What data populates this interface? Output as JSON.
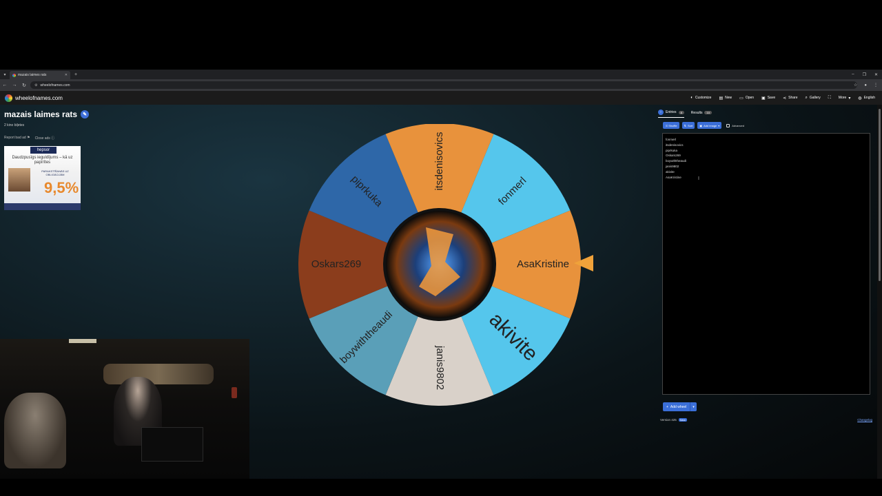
{
  "browser": {
    "tab_title": "mazais laimes rats",
    "url": "wheelofnames.com"
  },
  "header": {
    "logo_text": "wheelofnames.com",
    "menu": [
      {
        "label": "Customize",
        "icon": "palette-icon"
      },
      {
        "label": "New",
        "icon": "file-icon"
      },
      {
        "label": "Open",
        "icon": "folder-icon"
      },
      {
        "label": "Save",
        "icon": "save-icon"
      },
      {
        "label": "Share",
        "icon": "share-icon"
      },
      {
        "label": "Gallery",
        "icon": "search-icon"
      },
      {
        "label": "",
        "icon": "fullscreen-icon"
      },
      {
        "label": "More",
        "icon": "chevron-down-icon"
      },
      {
        "label": "English",
        "icon": "globe-icon"
      }
    ]
  },
  "page": {
    "title": "mazais laimes rats",
    "subtitle": "2 kino biļetes",
    "report_ad": "Report bad ad",
    "close_ads": "Close ads"
  },
  "ad": {
    "brand": "hepsor",
    "headline": "Daudzpusīgs ieguldījums – kā uz papīrītes",
    "tagline": "PARAKSTĪŠANĀS UZ OBLIGĀCIJĀM",
    "percent": "9,5%"
  },
  "wheel": {
    "segments": [
      {
        "label": "fonmerl",
        "color": "#55c6ec"
      },
      {
        "label": "AsaKristine",
        "color": "#e8923c"
      },
      {
        "label": "akivite",
        "color": "#55c6ec"
      },
      {
        "label": "janis9802",
        "color": "#d9d1c9"
      },
      {
        "label": "boywiththeaudi",
        "color": "#5a9fb8"
      },
      {
        "label": "Oskars269",
        "color": "#8b3d1c"
      },
      {
        "label": "piprkuka",
        "color": "#2e67a8"
      },
      {
        "label": "itsdenisovics",
        "color": "#e8923c"
      }
    ],
    "pointer_color": "#f0a23a"
  },
  "panel": {
    "tabs": [
      {
        "label": "Entries",
        "count": "8"
      },
      {
        "label": "Results",
        "count": "10"
      }
    ],
    "toolbar": {
      "shuffle": "Shuffle",
      "sort": "Sort",
      "add_image": "Add image",
      "advanced": "Advanced"
    },
    "entries": [
      "fonmerl",
      "itsdenisovics",
      "piprkuka",
      "Oskars269",
      "boywiththeaudi",
      "janis9802",
      "akivite",
      "AsaKristine"
    ],
    "add_wheel": "Add wheel",
    "version": "Version 425",
    "new_badge": "New",
    "changelog": "Changelog"
  },
  "colors": {
    "accent": "#3b6fd8",
    "background": "#0b1418"
  }
}
